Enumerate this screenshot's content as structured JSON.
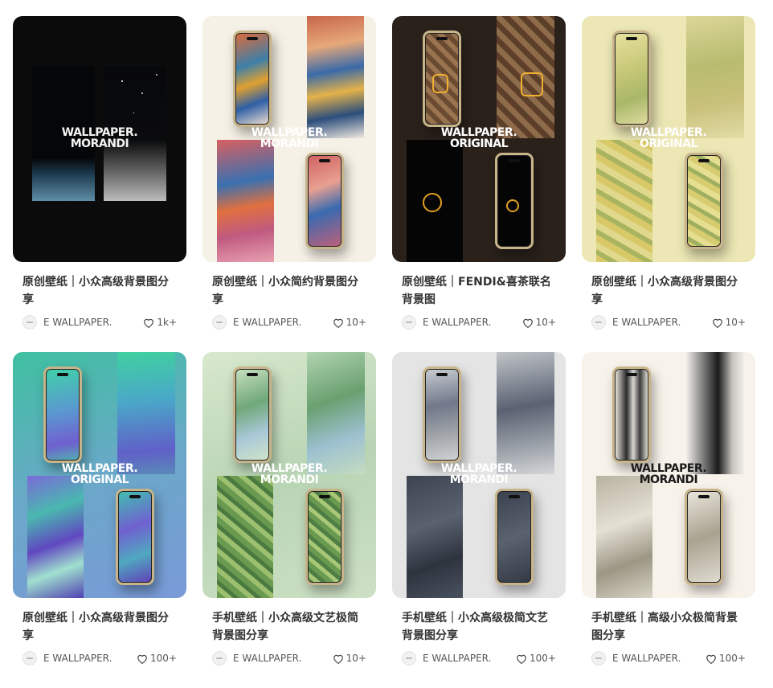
{
  "cards": [
    {
      "title": "原创壁纸｜小众高级背景图分享",
      "author": "E WALLPAPER.",
      "likes": "1k+",
      "wm1": "WALLPAPER.",
      "wm2": "MORANDI"
    },
    {
      "title": "原创壁纸｜小众简约背景图分享",
      "author": "E WALLPAPER.",
      "likes": "10+",
      "wm1": "WALLPAPER.",
      "wm2": "MORANDI"
    },
    {
      "title": "原创壁纸｜FENDI&喜茶联名背景图",
      "author": "E WALLPAPER.",
      "likes": "10+",
      "wm1": "WALLPAPER.",
      "wm2": "ORIGINAL"
    },
    {
      "title": "原创壁纸｜小众高级背景图分享",
      "author": "E WALLPAPER.",
      "likes": "10+",
      "wm1": "WALLPAPER.",
      "wm2": "ORIGINAL"
    },
    {
      "title": "原创壁纸｜小众高级背景图分享",
      "author": "E WALLPAPER.",
      "likes": "100+",
      "wm1": "WALLPAPER.",
      "wm2": "ORIGINAL"
    },
    {
      "title": "手机壁纸｜小众高级文艺极简背景图分享",
      "author": "E WALLPAPER.",
      "likes": "10+",
      "wm1": "WALLPAPER.",
      "wm2": "MORANDI"
    },
    {
      "title": "手机壁纸｜小众高级极简文艺背景图分享",
      "author": "E WALLPAPER.",
      "likes": "100+",
      "wm1": "WALLPAPER.",
      "wm2": "MORANDI"
    },
    {
      "title": "手机壁纸｜高级小众极简背景图分享",
      "author": "E WALLPAPER.",
      "likes": "100+",
      "wm1": "WALLPAPER.",
      "wm2": "MORANDI"
    }
  ]
}
